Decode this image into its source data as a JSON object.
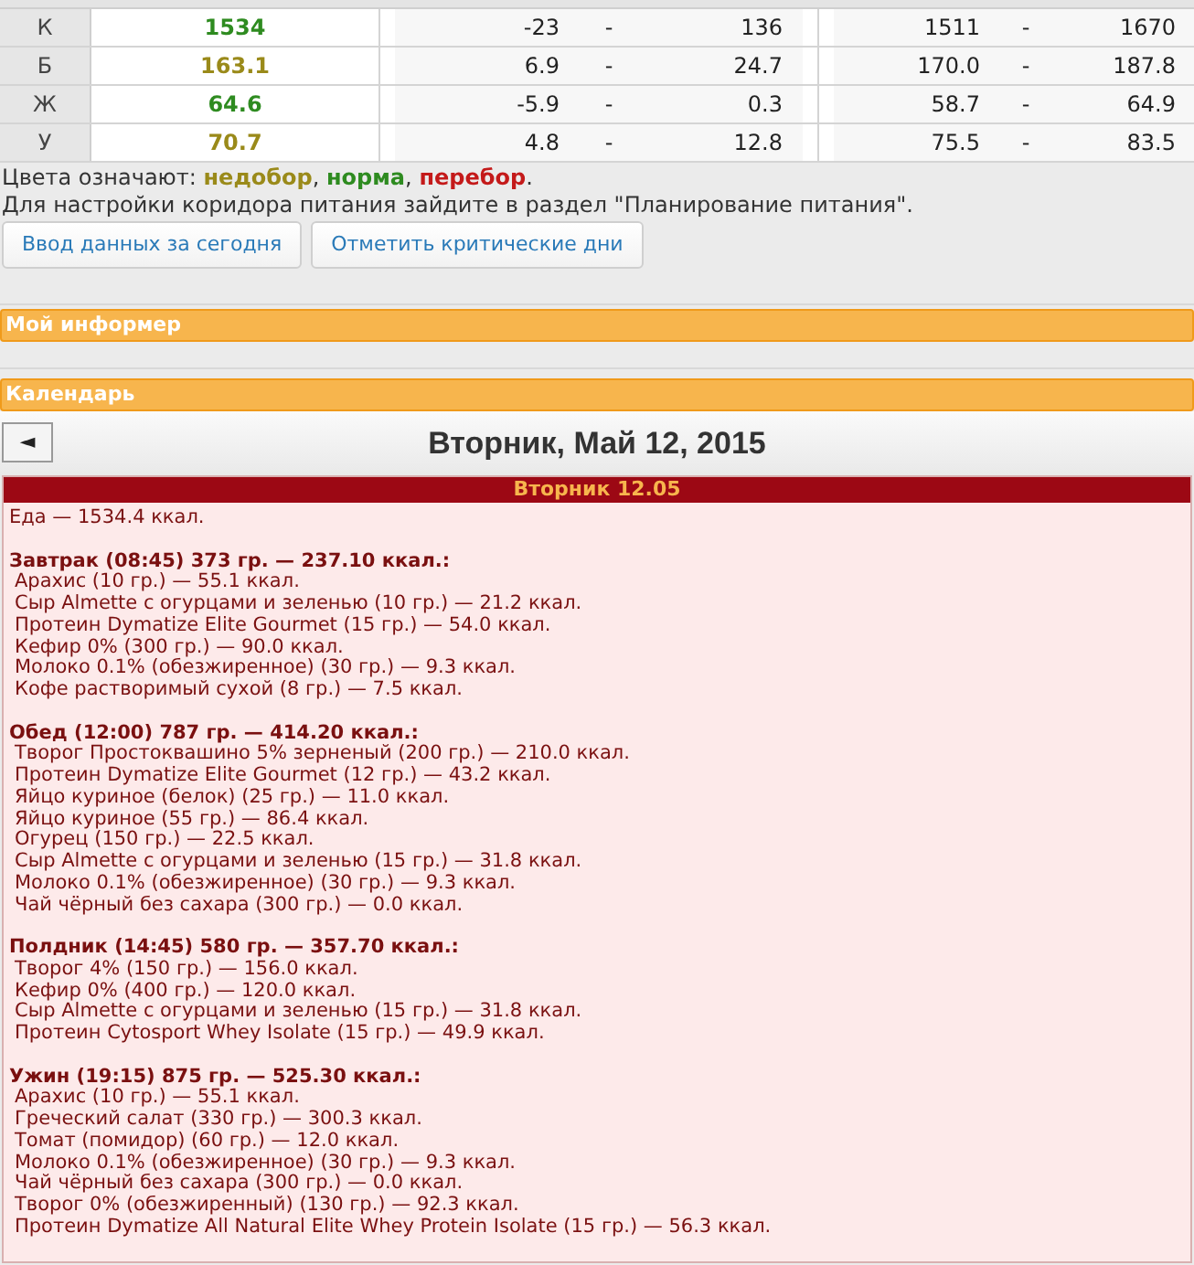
{
  "table": {
    "rows": [
      {
        "label": "К",
        "value": "1534",
        "color": "#2e8b20",
        "rest_from": "-23",
        "rest_sep": "-",
        "rest_to": "136",
        "range_from": "1511",
        "range_sep": "-",
        "range_to": "1670"
      },
      {
        "label": "Б",
        "value": "163.1",
        "color": "#9a8a1a",
        "rest_from": "6.9",
        "rest_sep": "-",
        "rest_to": "24.7",
        "range_from": "170.0",
        "range_sep": "-",
        "range_to": "187.8"
      },
      {
        "label": "Ж",
        "value": "64.6",
        "color": "#2e8b20",
        "rest_from": "-5.9",
        "rest_sep": "-",
        "rest_to": "0.3",
        "range_from": "58.7",
        "range_sep": "-",
        "range_to": "64.9"
      },
      {
        "label": "У",
        "value": "70.7",
        "color": "#9a8a1a",
        "rest_from": "4.8",
        "rest_sep": "-",
        "rest_to": "12.8",
        "range_from": "75.5",
        "range_sep": "-",
        "range_to": "83.5"
      }
    ]
  },
  "legend": {
    "prefix": "Цвета означают:",
    "items": [
      {
        "text": "недобор",
        "suffix": ",",
        "color": "#9a8a1a"
      },
      {
        "text": "норма",
        "suffix": ",",
        "color": "#2e8b20"
      },
      {
        "text": "перебор",
        "suffix": ".",
        "color": "#c41a1a"
      }
    ]
  },
  "hint": "Для настройки коридора питания зайдите в раздел \"Планирование питания\".",
  "buttons": [
    "Ввод данных за сегодня",
    "Отметить критические дни"
  ],
  "informer": {
    "title": "Мой информер"
  },
  "calendar": {
    "title": "Календарь",
    "prev": "◄",
    "date": "Вторник, Май 12, 2015",
    "day_header": "Вторник 12.05",
    "total": "Еда — 1534.4 ккал.",
    "meals": [
      {
        "title": "Завтрак (08:45) 373 гр. — 237.10 ккал.:",
        "items": [
          "Арахис (10 гр.) — 55.1 ккал.",
          "Сыр Almette с огурцами и зеленью (10 гр.) — 21.2 ккал.",
          "Протеин Dymatize Elite Gourmet (15 гр.) — 54.0 ккал.",
          "Кефир 0% (300 гр.) — 90.0 ккал.",
          "Молоко 0.1% (обезжиренное) (30 гр.) — 9.3 ккал.",
          "Кофе растворимый сухой (8 гр.) — 7.5 ккал."
        ]
      },
      {
        "title": "Обед (12:00) 787 гр. — 414.20 ккал.:",
        "items": [
          "Творог Простоквашино 5% зерненый (200 гр.) — 210.0 ккал.",
          "Протеин Dymatize Elite Gourmet (12 гр.) — 43.2 ккал.",
          "Яйцо куриное (белок) (25 гр.) — 11.0 ккал.",
          "Яйцо куриное (55 гр.) — 86.4 ккал.",
          "Огурец (150 гр.) — 22.5 ккал.",
          "Сыр Almette с огурцами и зеленью (15 гр.) — 31.8 ккал.",
          "Молоко 0.1% (обезжиренное) (30 гр.) — 9.3 ккал.",
          "Чай чёрный без сахара (300 гр.) — 0.0 ккал."
        ]
      },
      {
        "title": "Полдник (14:45) 580 гр. — 357.70 ккал.:",
        "items": [
          "Творог 4% (150 гр.) — 156.0 ккал.",
          "Кефир 0% (400 гр.) — 120.0 ккал.",
          "Сыр Almette с огурцами и зеленью (15 гр.) — 31.8 ккал.",
          "Протеин Cytosport Whey Isolate (15 гр.) — 49.9 ккал."
        ]
      },
      {
        "title": "Ужин (19:15) 875 гр. — 525.30 ккал.:",
        "items": [
          "Арахис (10 гр.) — 55.1 ккал.",
          "Греческий салат (330 гр.) — 300.3 ккал.",
          "Томат (помидор) (60 гр.) — 12.0 ккал.",
          "Молоко 0.1% (обезжиренное) (30 гр.) — 9.3 ккал.",
          "Чай чёрный без сахара (300 гр.) — 0.0 ккал.",
          "Творог 0% (обезжиренный) (130 гр.) — 92.3 ккал.",
          "Протеин Dymatize All Natural Elite Whey Protein Isolate (15 гр.) — 56.3 ккал."
        ]
      }
    ]
  }
}
